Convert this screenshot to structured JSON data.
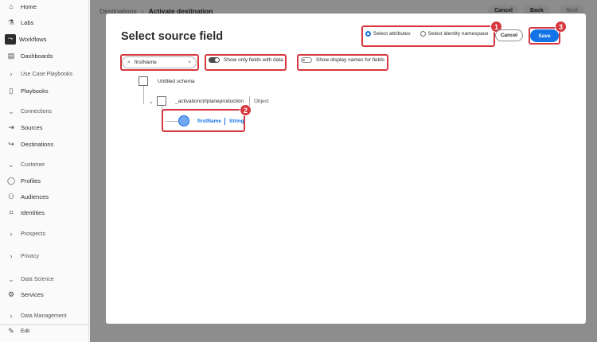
{
  "sidebar": {
    "items": [
      {
        "label": "Home",
        "icon": "home-icon",
        "glyph": "⌂"
      },
      {
        "label": "Labs",
        "icon": "flask-icon",
        "glyph": "⚗"
      },
      {
        "label": "Workflows",
        "icon": "workflow-icon",
        "glyph": "⤳",
        "active": true
      },
      {
        "label": "Dashboards",
        "icon": "dashboard-icon",
        "glyph": "▤"
      },
      {
        "label": "Use Case Playbooks",
        "icon": "chevron-right-icon",
        "glyph": "›"
      },
      {
        "label": "Playbooks",
        "icon": "book-icon",
        "glyph": "▯"
      },
      {
        "label": "Connections",
        "icon": "chevron-down-icon",
        "glyph": "⌄"
      },
      {
        "label": "Sources",
        "icon": "source-icon",
        "glyph": "⇥"
      },
      {
        "label": "Destinations",
        "icon": "destination-icon",
        "glyph": "↪"
      },
      {
        "label": "Customer",
        "icon": "chevron-down-icon",
        "glyph": "⌄"
      },
      {
        "label": "Profiles",
        "icon": "profile-icon",
        "glyph": "◯"
      },
      {
        "label": "Audiences",
        "icon": "audience-icon",
        "glyph": "⚇"
      },
      {
        "label": "Identities",
        "icon": "identity-icon",
        "glyph": "⌗"
      },
      {
        "label": "Prospects",
        "icon": "chevron-right-icon",
        "glyph": "›"
      },
      {
        "label": "Privacy",
        "icon": "chevron-right-icon",
        "glyph": "›"
      },
      {
        "label": "Data Science",
        "icon": "chevron-down-icon",
        "glyph": "⌄"
      },
      {
        "label": "Services",
        "icon": "services-icon",
        "glyph": "⚙"
      },
      {
        "label": "Data Management",
        "icon": "chevron-right-icon",
        "glyph": "›"
      }
    ],
    "edit_label": "Edit"
  },
  "page": {
    "breadcrumb_parent": "Destinations",
    "breadcrumb_sep": "›",
    "breadcrumb_current": "Activate destination",
    "cancel_label": "Cancel",
    "back_label": "Back",
    "next_label": "Next"
  },
  "modal": {
    "title": "Select source field",
    "radio_select_attributes": "Select attributes",
    "radio_select_identity": "Select identity namespace",
    "cancel_label": "Cancel",
    "save_label": "Save",
    "search_value": "firstName",
    "toggle_only_fields": "Show only fields with data",
    "toggle_display_names": "Show display names for fields",
    "tree": {
      "root_label": "Untitled schema",
      "object_label": "_activationctrlplaneproduction",
      "object_type": "Object",
      "field_name": "firstName",
      "field_type": "String"
    }
  },
  "callouts": [
    "1",
    "2",
    "3"
  ],
  "colors": {
    "accent": "#1473e6",
    "highlight": "#d7373f"
  }
}
